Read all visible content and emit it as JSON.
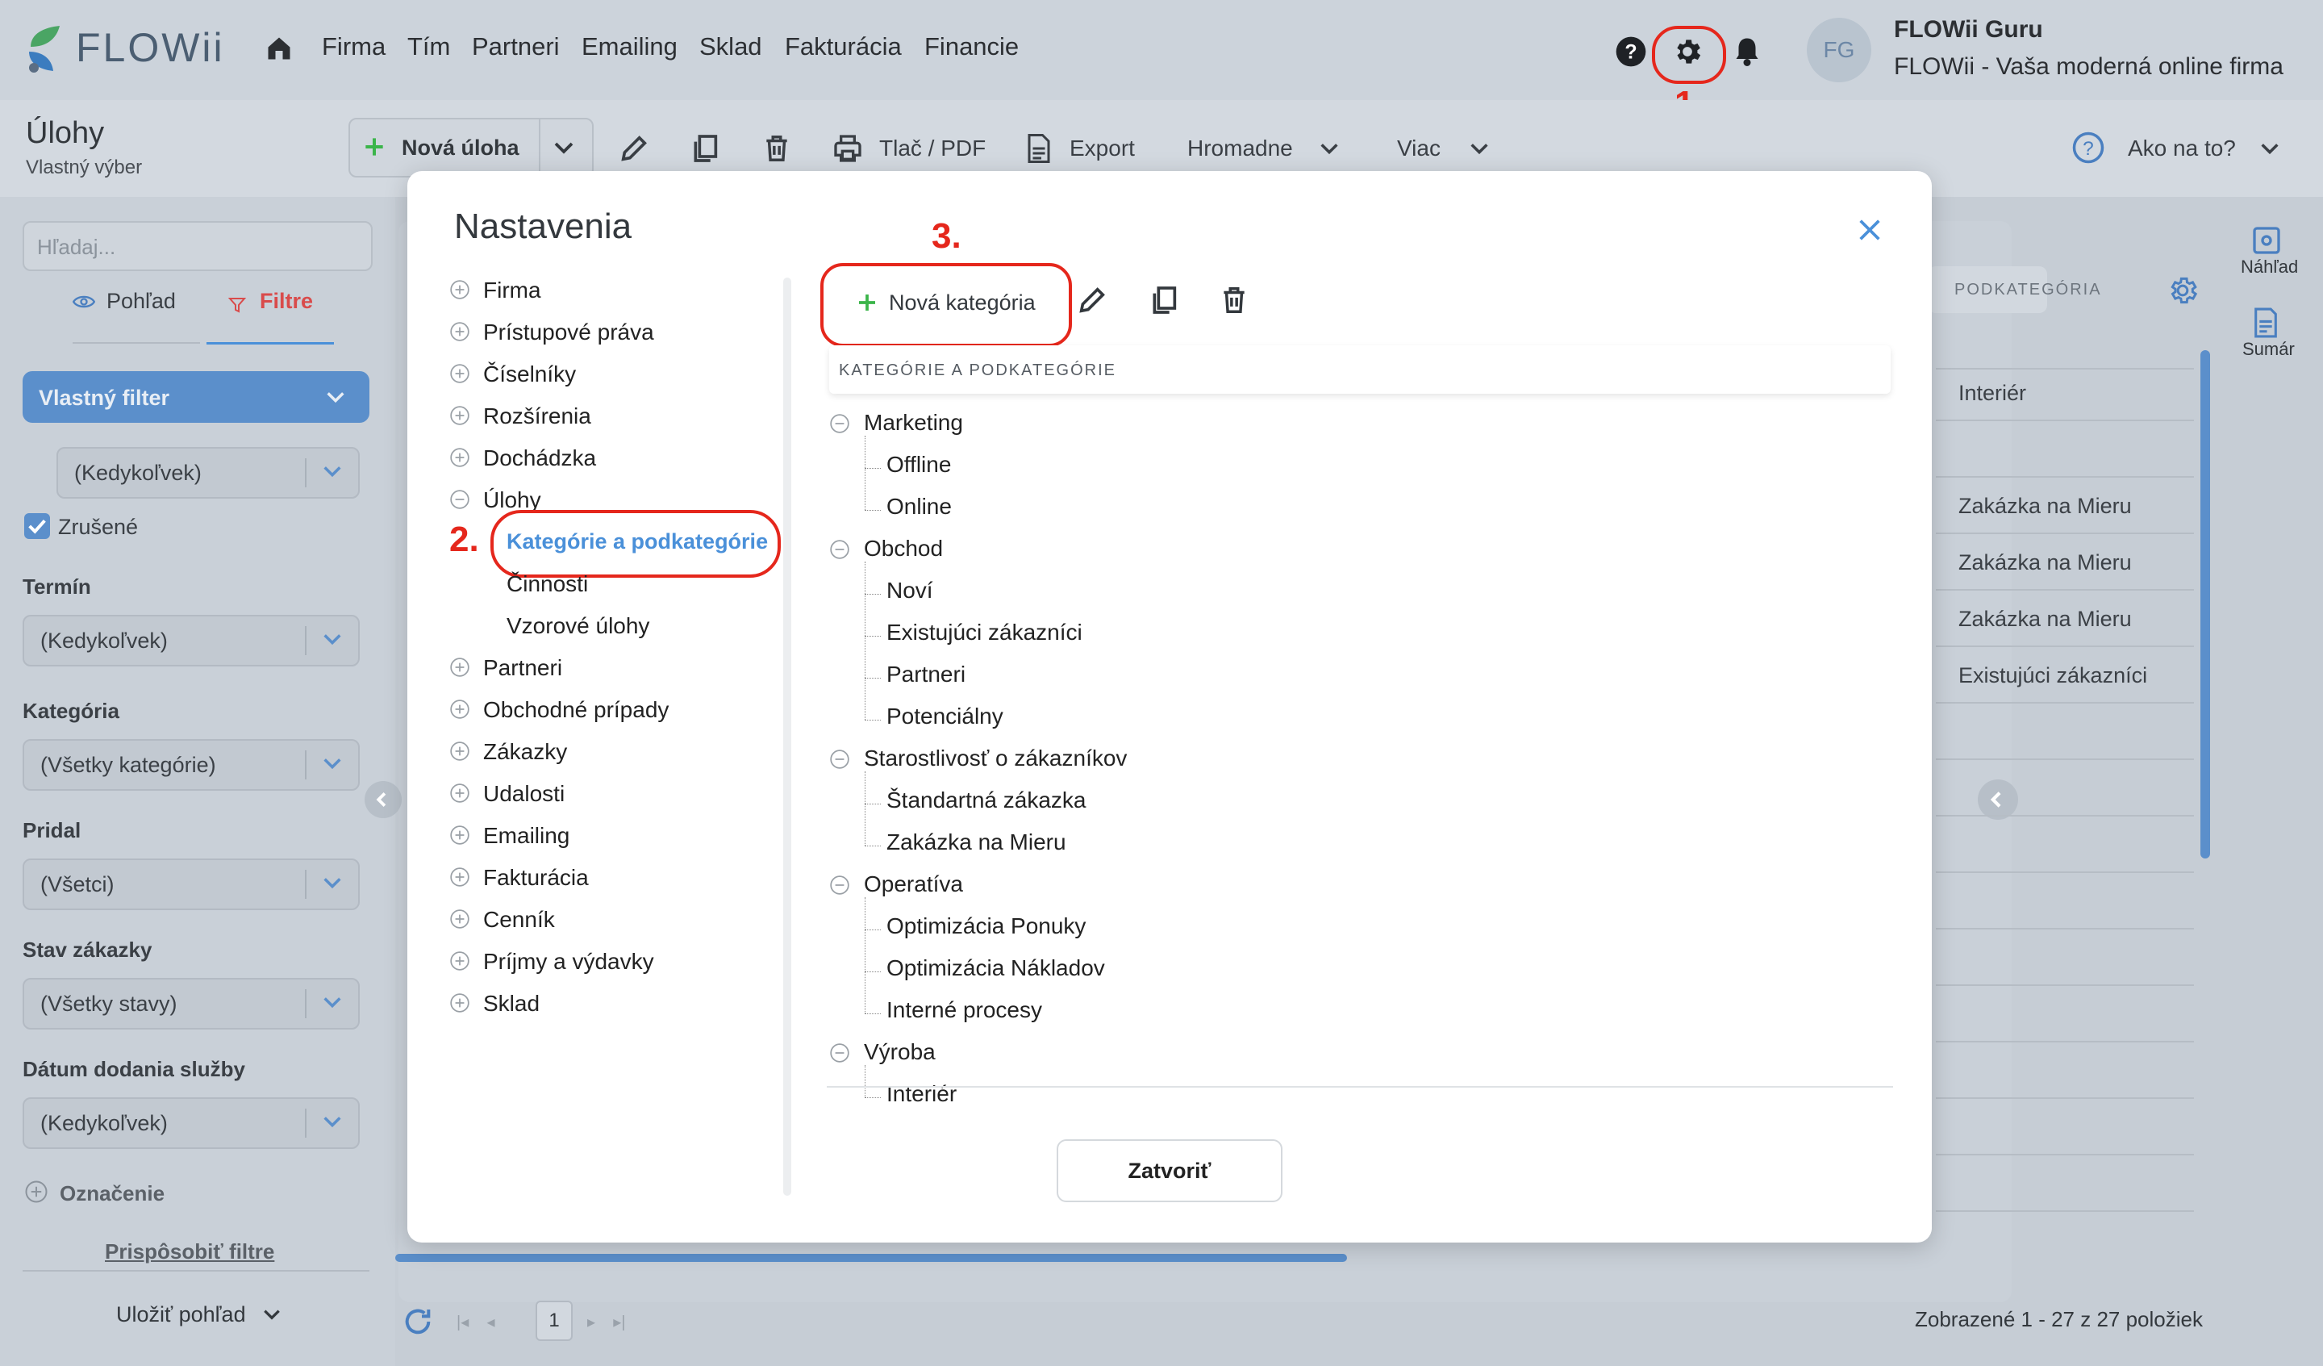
{
  "app": {
    "logo_text": "FLOWii",
    "nav": [
      "Firma",
      "Tím",
      "Partneri",
      "Emailing",
      "Sklad",
      "Fakturácia",
      "Financie"
    ],
    "user": {
      "initials": "FG",
      "name": "FLOWii Guru",
      "company": "FLOWii - Vaša moderná online firma"
    }
  },
  "page": {
    "title": "Úlohy",
    "subtitle": "Vlastný výber"
  },
  "toolbar": {
    "new_task": "Nová úloha",
    "print": "Tlač / PDF",
    "export": "Export",
    "bulk": "Hromadne",
    "more": "Viac",
    "help": "Ako na to?"
  },
  "sidebar": {
    "search_placeholder": "Hľadaj...",
    "tab_view": "Pohľad",
    "tab_filters": "Filtre",
    "custom_filter": "Vlastný filter",
    "top_select": "(Kedykoľvek)",
    "cancelled_label": "Zrušené",
    "filters": [
      {
        "label": "Termín",
        "value": "(Kedykoľvek)"
      },
      {
        "label": "Kategória",
        "value": "(Všetky kategórie)"
      },
      {
        "label": "Pridal",
        "value": "(Všetci)"
      },
      {
        "label": "Stav zákazky",
        "value": "(Všetky stavy)"
      },
      {
        "label": "Dátum dodania služby",
        "value": "(Kedykoľvek)"
      }
    ],
    "marking": "Označenie",
    "customize": "Prispôsobiť filtre",
    "save_view": "Uložiť pohľad"
  },
  "grid": {
    "col_header": "PODKATEGÓRIA",
    "cells": [
      "Interiér",
      "Zakázka na Mieru",
      "Zakázka na Mieru",
      "Zakázka na Mieru",
      "Existujúci zákazníci"
    ],
    "right_preview": "Náhľad",
    "right_summary": "Sumár",
    "page_number": "1",
    "footer": "Zobrazené 1 - 27 z 27 položiek"
  },
  "modal": {
    "title": "Nastavenia",
    "menu": [
      {
        "label": "Firma",
        "expanded": false
      },
      {
        "label": "Prístupové práva",
        "expanded": false
      },
      {
        "label": "Číselníky",
        "expanded": false
      },
      {
        "label": "Rozšírenia",
        "expanded": false
      },
      {
        "label": "Dochádzka",
        "expanded": false
      },
      {
        "label": "Úlohy",
        "expanded": true
      }
    ],
    "submenu": [
      "Kategórie a podkategórie",
      "Činnosti",
      "Vzorové úlohy"
    ],
    "menu_rest": [
      "Partneri",
      "Obchodné prípady",
      "Zákazky",
      "Udalosti",
      "Emailing",
      "Fakturácia",
      "Cenník",
      "Príjmy a výdavky",
      "Sklad"
    ],
    "new_category": "Nová kategória",
    "tree_header": "KATEGÓRIE A PODKATEGÓRIE",
    "categories": [
      {
        "name": "Marketing",
        "children": [
          "Offline",
          "Online"
        ]
      },
      {
        "name": "Obchod",
        "children": [
          "Noví",
          "Existujúci zákazníci",
          "Partneri",
          "Potenciálny"
        ]
      },
      {
        "name": "Starostlivosť o zákazníkov",
        "children": [
          "Štandartná zákazka",
          "Zakázka na Mieru"
        ]
      },
      {
        "name": "Operatíva",
        "children": [
          "Optimizácia Ponuky",
          "Optimizácia Nákladov",
          "Interné procesy"
        ]
      },
      {
        "name": "Výroba",
        "children": [
          "Interiér"
        ]
      }
    ],
    "close_button": "Zatvoriť"
  },
  "annotations": [
    "1.",
    "2.",
    "3."
  ],
  "colors": {
    "accent_blue": "#4a90d9",
    "annotation_red": "#e5271c",
    "plus_green": "#3bb54a"
  }
}
